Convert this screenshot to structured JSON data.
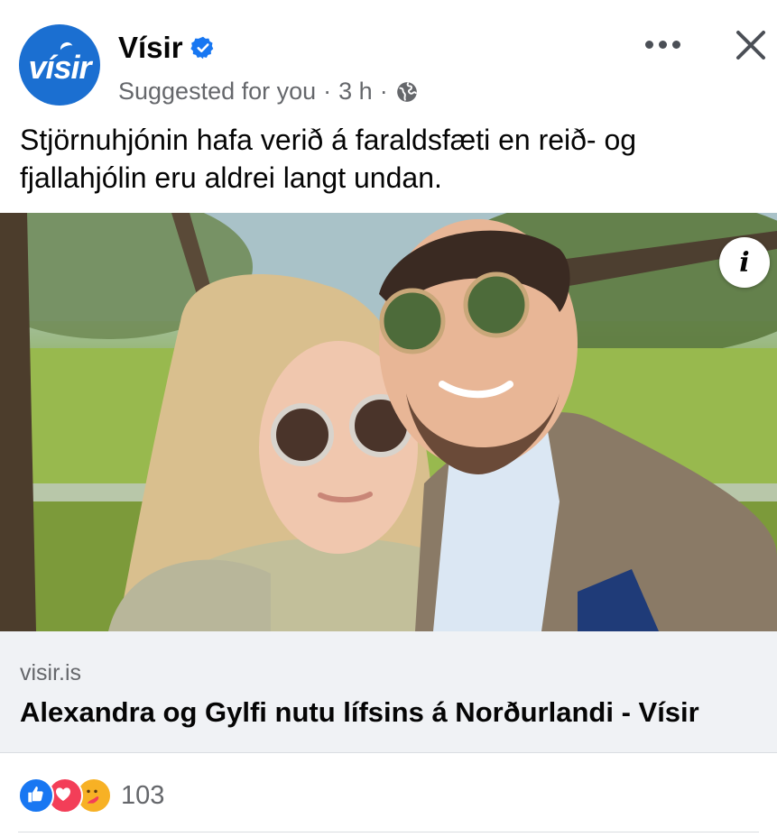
{
  "post": {
    "page_name": "Vísir",
    "avatar_text": "vísir",
    "meta_suggested": "Suggested for you",
    "meta_separator": "·",
    "meta_time": "3 h",
    "meta_separator2": "·",
    "caption": "Stjörnuhjónin hafa verið á faraldsfæti en reið- og fjallahjólin eru aldrei langt undan."
  },
  "icons": {
    "verified": "verified-badge-icon",
    "audience": "globe-icon",
    "more": "more-options-icon",
    "close": "close-icon",
    "info": "info-icon",
    "reactions": [
      "like-icon",
      "love-icon",
      "care-icon"
    ]
  },
  "image": {
    "description_tag": "photo"
  },
  "info_button": {
    "label": "i"
  },
  "link": {
    "domain": "visir.is",
    "title": "Alexandra og Gylfi nutu lífsins á Norðurlandi - Vísir"
  },
  "reactions": {
    "count": "103"
  },
  "colors": {
    "brand_blue": "#1b6fd1",
    "verified_blue": "#1877f2",
    "secondary_text": "#65676b",
    "link_bg": "#f0f2f5",
    "like_blue": "#1877f2",
    "love_red": "#f33e58",
    "care_yellow": "#f7b125"
  }
}
